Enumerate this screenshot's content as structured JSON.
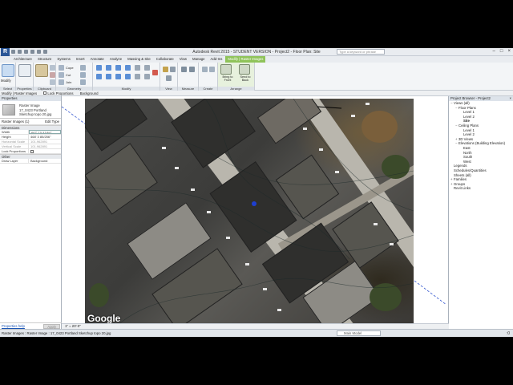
{
  "app": {
    "title": "Autodesk Revit 2015 - STUDENT VERSION -",
    "project": "Project2 - Floor Plan: Site",
    "search_placeholder": "Type a keyword or phrase"
  },
  "tabs": [
    "Architecture",
    "Structure",
    "Systems",
    "Insert",
    "Annotate",
    "Analyze",
    "Massing & Site",
    "Collaborate",
    "View",
    "Manage",
    "Add-Ins",
    "Modify | Raster Images"
  ],
  "active_tab": "Modify | Raster Images",
  "ribbon_panels": {
    "select": "Select",
    "properties": "Properties",
    "clipboard": "Clipboard",
    "geometry": "Geometry",
    "modify": "Modify",
    "view": "View",
    "measure": "Measure",
    "create": "Create",
    "arrange": "Arrange"
  },
  "ribbon_tools": {
    "modify": "Modify",
    "cope": "Cope",
    "cut": "Cut",
    "join": "Join",
    "bring_to_front": "Bring to Front",
    "send_to_back": "Send to Back"
  },
  "options_bar": {
    "context": "Modify | Raster Images",
    "lock_proportions": "Lock Proportions",
    "background_label": "Background"
  },
  "properties": {
    "header": "Properties",
    "type_name": "Raster Image",
    "type_file": "17_0423 Portland Sketchup topo 20.jpg",
    "selector": "Raster Images (1)",
    "edit_type": "Edit Type",
    "categories": {
      "dimensions": "Dimensions",
      "other": "Other"
    },
    "rows": [
      {
        "k": "Width",
        "v": "667' 10 41/64\""
      },
      {
        "k": "Height",
        "v": "468' 3 85/256\""
      },
      {
        "k": "Horizontal Scale",
        "v": "101.962891"
      },
      {
        "k": "Vertical Scale",
        "v": "101.962891"
      },
      {
        "k": "Lock Proportions",
        "v": ""
      }
    ],
    "other_rows": [
      {
        "k": "Draw Layer",
        "v": "Background"
      }
    ],
    "help_link": "Properties help",
    "apply": "Apply"
  },
  "view": {
    "google_watermark": "Google",
    "scale": "1\" = 20'-0\""
  },
  "project_browser": {
    "header": "Project Browser - Project2",
    "items": [
      {
        "label": "Views (all)",
        "level": 0,
        "toggle": "−"
      },
      {
        "label": "Floor Plans",
        "level": 1,
        "toggle": "−"
      },
      {
        "label": "Level 1",
        "level": 2,
        "toggle": ""
      },
      {
        "label": "Level 2",
        "level": 2,
        "toggle": ""
      },
      {
        "label": "Site",
        "level": 2,
        "toggle": "",
        "selected": true
      },
      {
        "label": "Ceiling Plans",
        "level": 1,
        "toggle": "−"
      },
      {
        "label": "Level 1",
        "level": 2,
        "toggle": ""
      },
      {
        "label": "Level 2",
        "level": 2,
        "toggle": ""
      },
      {
        "label": "3D Views",
        "level": 1,
        "toggle": "+"
      },
      {
        "label": "Elevations (Building Elevation)",
        "level": 1,
        "toggle": "−"
      },
      {
        "label": "East",
        "level": 2,
        "toggle": ""
      },
      {
        "label": "North",
        "level": 2,
        "toggle": ""
      },
      {
        "label": "South",
        "level": 2,
        "toggle": ""
      },
      {
        "label": "West",
        "level": 2,
        "toggle": ""
      },
      {
        "label": "Legends",
        "level": 0,
        "toggle": ""
      },
      {
        "label": "Schedules/Quantities",
        "level": 0,
        "toggle": ""
      },
      {
        "label": "Sheets (all)",
        "level": 0,
        "toggle": ""
      },
      {
        "label": "Families",
        "level": 0,
        "toggle": "+"
      },
      {
        "label": "Groups",
        "level": 0,
        "toggle": "+"
      },
      {
        "label": "Revit Links",
        "level": 0,
        "toggle": ""
      }
    ]
  },
  "status": {
    "text": "Raster Images : Raster Image : 17_0423 Portland Sketchup topo 20.jpg",
    "model": "Main Model",
    "filter": ":0"
  },
  "colors": {
    "context_tab": "#8fc35a",
    "accent": "#2b5797"
  }
}
